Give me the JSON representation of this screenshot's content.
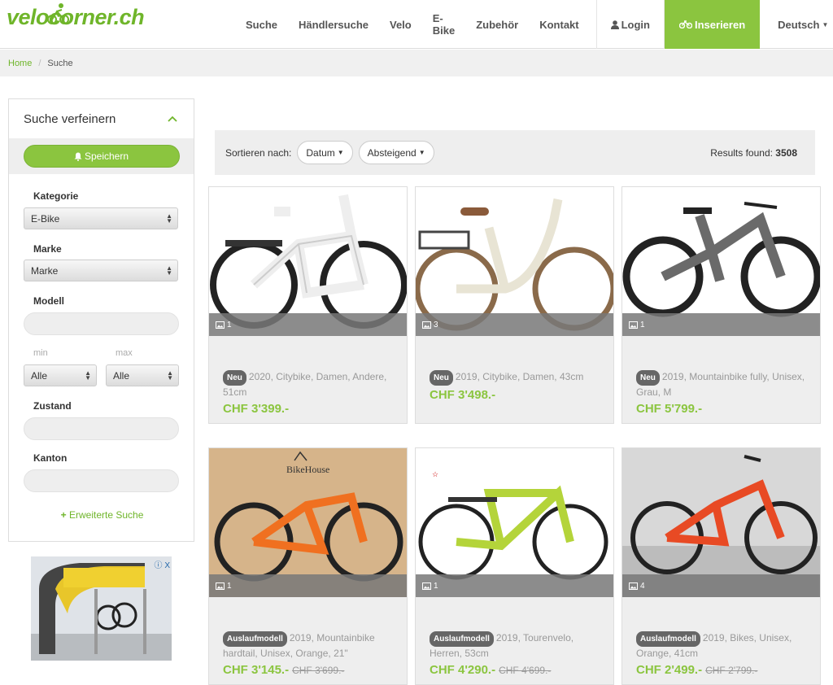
{
  "brand": {
    "logo_text_a": "velo",
    "logo_text_b": "corner.ch"
  },
  "nav": {
    "items": [
      "Suche",
      "Händlersuche",
      "Velo",
      "E-Bike",
      "Zubehör",
      "Kontakt"
    ],
    "login": "Login",
    "inserieren": "Inserieren",
    "language": "Deutsch"
  },
  "breadcrumb": {
    "home": "Home",
    "separator": "/",
    "current": "Suche"
  },
  "sidebar": {
    "title": "Suche verfeinern",
    "save_label": "Speichern",
    "kategorie_label": "Kategorie",
    "kategorie_value": "E-Bike",
    "marke_label": "Marke",
    "marke_value": "Marke",
    "modell_label": "Modell",
    "min_label": "min",
    "max_label": "max",
    "min_value": "Alle",
    "max_value": "Alle",
    "zustand_label": "Zustand",
    "kanton_label": "Kanton",
    "advanced_label": "Erweiterte Suche"
  },
  "toolbar": {
    "sort_label": "Sortieren nach:",
    "sort_field": "Datum",
    "sort_order": "Absteigend",
    "results_label": "Results found:",
    "results_count": "3508"
  },
  "listings": [
    {
      "badge": "Neu",
      "desc": "2020, Citybike, Damen, Andere, 51cm",
      "price": "CHF 3'399.-",
      "old_price": "",
      "photos": "1"
    },
    {
      "badge": "Neu",
      "desc": "2019, Citybike, Damen, 43cm",
      "price": "CHF 3'498.-",
      "old_price": "",
      "photos": "3"
    },
    {
      "badge": "Neu",
      "desc": "2019, Mountainbike fully, Unisex, Grau, M",
      "price": "CHF 5'799.-",
      "old_price": "",
      "photos": "1"
    },
    {
      "badge": "Auslaufmodell",
      "desc": "2019, Mountainbike hardtail, Unisex, Orange, 21\"",
      "price": "CHF 3'145.-",
      "old_price": "CHF 3'699.-",
      "photos": "1"
    },
    {
      "badge": "Auslaufmodell",
      "desc": "2019, Tourenvelo, Herren, 53cm",
      "price": "CHF 4'290.-",
      "old_price": "CHF 4'699.-",
      "photos": "1"
    },
    {
      "badge": "Auslaufmodell",
      "desc": "2019, Bikes, Unisex, Orange, 41cm",
      "price": "CHF 2'499.-",
      "old_price": "CHF 2'799.-",
      "photos": "4"
    }
  ],
  "ad": {
    "badge": "ⓘ X",
    "image_text": "BikeHouse"
  },
  "colors": {
    "accent": "#8bc53f",
    "brand": "#6fb52a"
  }
}
